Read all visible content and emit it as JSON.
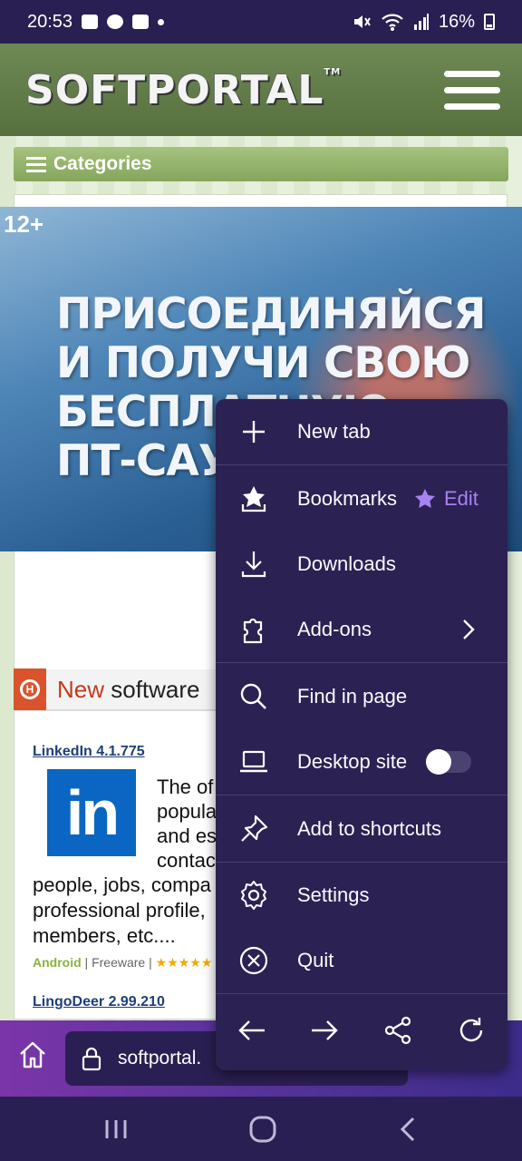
{
  "status_bar": {
    "time": "20:53",
    "battery": "16%"
  },
  "site": {
    "logo": "SOFTPORTAL",
    "logo_tm": "TM",
    "categories_label": "Categories",
    "ad": {
      "age_rating": "12+",
      "lines": [
        "ПРИСОЕДИНЯЙСЯ",
        "И ПОЛУЧИ СВОЮ",
        "БЕСПЛАТНУЮ",
        "ПТ-САУ"
      ]
    },
    "section": {
      "logo_letter": "H",
      "title_highlight": "New",
      "title_rest": " software"
    },
    "items": [
      {
        "title": "LinkedIn 4.1.775",
        "logo_text": "in",
        "desc_lines": [
          "The of",
          "popula",
          "and es",
          "contac",
          "people, jobs, compa",
          "professional profile,",
          "members, etc...."
        ],
        "platform": "Android",
        "license": "Freeware",
        "stars": "★★★★★"
      },
      {
        "title": "LingoDeer 2.99.210"
      }
    ]
  },
  "browser": {
    "url": "softportal."
  },
  "menu": {
    "items": [
      {
        "label": "New tab",
        "icon": "plus-icon"
      },
      {
        "label": "Bookmarks",
        "icon": "bookmarks-icon",
        "edit_label": "Edit"
      },
      {
        "label": "Downloads",
        "icon": "download-icon"
      },
      {
        "label": "Add-ons",
        "icon": "puzzle-icon"
      },
      {
        "label": "Find in page",
        "icon": "search-icon"
      },
      {
        "label": "Desktop site",
        "icon": "laptop-icon",
        "toggle_on": false
      },
      {
        "label": "Add to shortcuts",
        "icon": "pin-icon"
      },
      {
        "label": "Settings",
        "icon": "gear-icon"
      },
      {
        "label": "Quit",
        "icon": "close-circle-icon"
      }
    ],
    "nav_icons": [
      "back-arrow-icon",
      "forward-arrow-icon",
      "share-icon",
      "reload-icon"
    ]
  },
  "colors": {
    "menu_bg": "#2b2153",
    "accent_purple": "#a782f2",
    "status_bar_bg": "#2a1f52"
  }
}
